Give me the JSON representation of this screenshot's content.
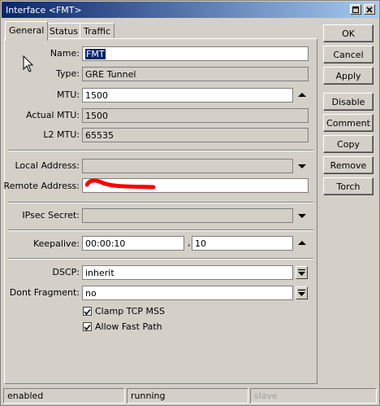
{
  "window": {
    "title": "Interface <FMT>",
    "controls": [
      "maximize-icon",
      "close-icon"
    ]
  },
  "tabs": [
    {
      "label": "General",
      "active": true
    },
    {
      "label": "Status",
      "active": false
    },
    {
      "label": "Traffic",
      "active": false
    }
  ],
  "form": {
    "name": {
      "label": "Name:",
      "value": "FMT"
    },
    "type": {
      "label": "Type:",
      "value": "GRE Tunnel"
    },
    "mtu": {
      "label": "MTU:",
      "value": "1500"
    },
    "actual_mtu": {
      "label": "Actual MTU:",
      "value": "1500"
    },
    "l2_mtu": {
      "label": "L2 MTU:",
      "value": "65535"
    },
    "local_address": {
      "label": "Local Address:",
      "value": ""
    },
    "remote_address": {
      "label": "Remote Address:",
      "value": ""
    },
    "ipsec_secret": {
      "label": "IPsec Secret:",
      "value": ""
    },
    "keepalive": {
      "label": "Keepalive:",
      "interval": "00:00:10",
      "separator": ",",
      "retries": "10"
    },
    "dscp": {
      "label": "DSCP:",
      "value": "inherit"
    },
    "dont_fragment": {
      "label": "Dont Fragment:",
      "value": "no"
    },
    "clamp_tcp_mss": {
      "label": "Clamp TCP MSS",
      "checked": true
    },
    "allow_fast_path": {
      "label": "Allow Fast Path",
      "checked": true
    }
  },
  "buttons": {
    "ok": "OK",
    "cancel": "Cancel",
    "apply": "Apply",
    "disable": "Disable",
    "comment": "Comment",
    "copy": "Copy",
    "remove": "Remove",
    "torch": "Torch"
  },
  "status": {
    "state": "enabled",
    "run": "running",
    "role": "slave"
  },
  "colors": {
    "window_bg": "#d4d0c8",
    "title_start": "#0a246a",
    "title_end": "#a6caf0",
    "selection": "#0a246a",
    "redaction": "#ff0000"
  }
}
